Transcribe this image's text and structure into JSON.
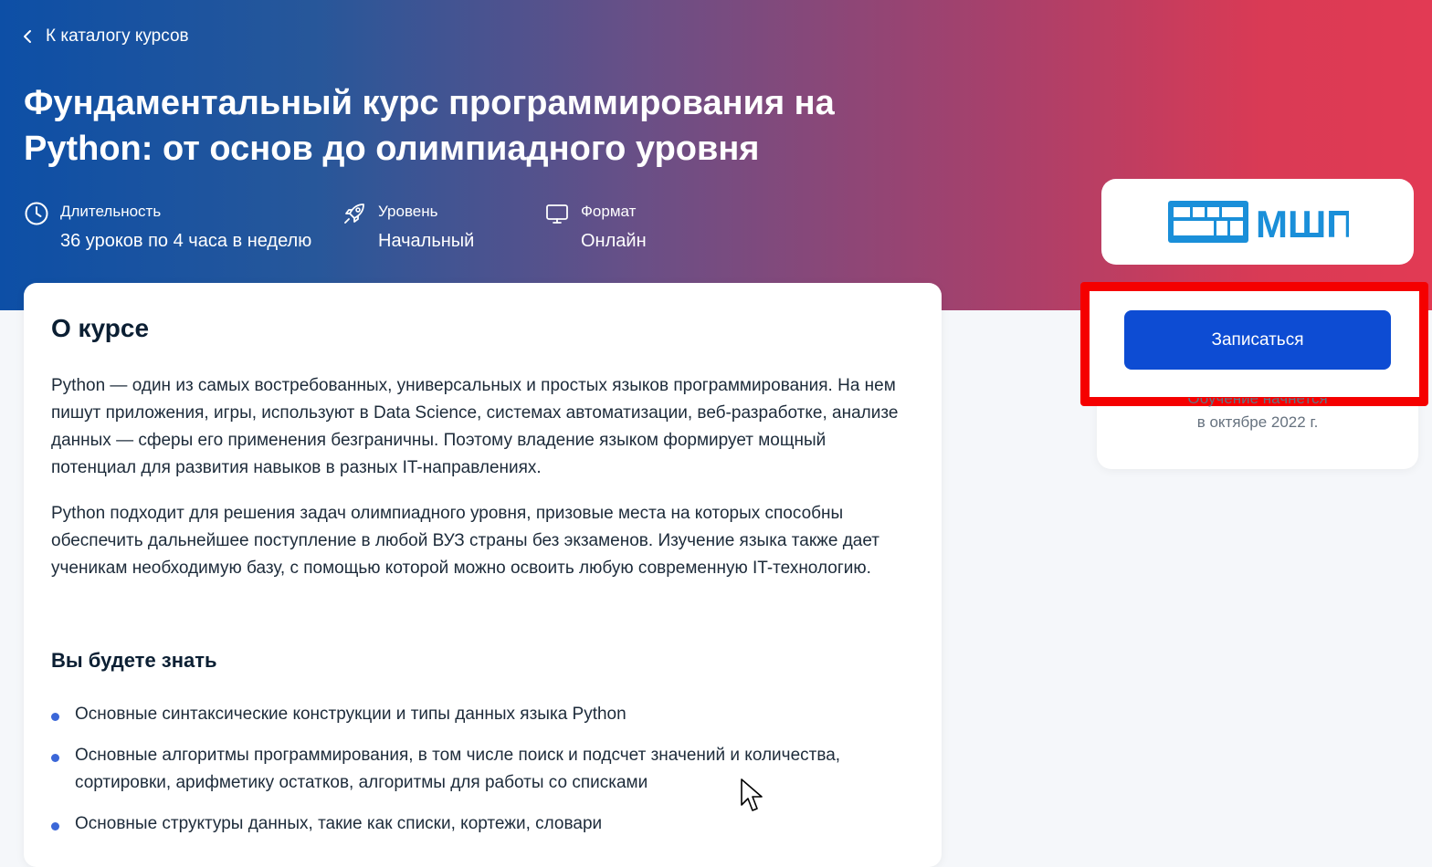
{
  "header": {
    "back_link": "К каталогу курсов",
    "title": "Фундаментальный курс программирования на Python: от основ до олимпиадного уровня",
    "meta": [
      {
        "icon": "clock-icon",
        "label": "Длительность",
        "value": "36 уроков по 4 часа в неделю"
      },
      {
        "icon": "rocket-icon",
        "label": "Уровень",
        "value": "Начальный"
      },
      {
        "icon": "monitor-icon",
        "label": "Формат",
        "value": "Онлайн"
      }
    ]
  },
  "about": {
    "title": "О курсе",
    "paragraphs": [
      "Python — один из самых востребованных, универсальных и простых языков программирования. На нем пишут приложения, игры, используют в Data Science, системах автоматизации, веб-разработке, анализе данных — сферы его применения безграничны. Поэтому владение языком формирует мощный потенциал для развития навыков в разных IT-направлениях.",
      "Python подходит для решения задач олимпиадного уровня, призовые места на которых способны обеспечить дальнейшее поступление в любой ВУЗ страны без экзаменов. Изучение языка также дает ученикам необходимую базу, с помощью которой можно освоить любую современную IT-технологию."
    ],
    "know_title": "Вы будете знать",
    "know_items": [
      "Основные синтаксические конструкции и типы данных языка Python",
      "Основные алгоритмы программирования, в том числе поиск и подсчет значений и количества, сортировки, арифметику остатков, алгоритмы для работы со списками",
      "Основные структуры данных, такие как списки, кортежи, словари"
    ]
  },
  "sidebar": {
    "logo_text": "МШП",
    "enroll_button": "Записаться",
    "start_line1": "Обучение начнется",
    "start_line2": "в октябре 2022 г."
  },
  "colors": {
    "hero_start": "#0d4fa6",
    "hero_end": "#e23a54",
    "button": "#0d4cd3",
    "highlight": "#f50000",
    "logo": "#1a8fd9"
  }
}
